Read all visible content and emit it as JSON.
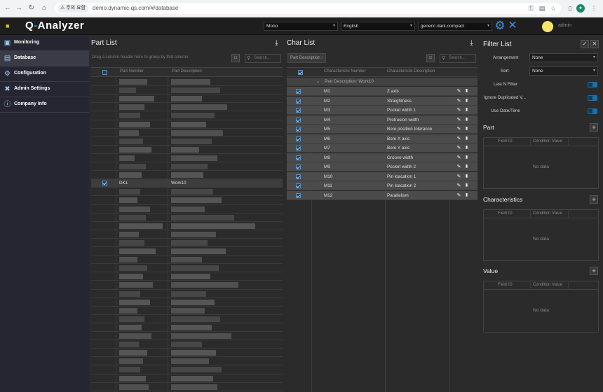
{
  "browser": {
    "security_label": "주의 요함",
    "url": "demo.dynamic-qs.com/#/database"
  },
  "header": {
    "logo": {
      "q": "Q",
      "dash": "-",
      "rest": "Analyzer"
    },
    "font_select": "Mono",
    "language_select": "English",
    "theme_select": "generic.dark.compact",
    "user": "admin"
  },
  "sidebar": {
    "items": [
      {
        "label": "Monitoring",
        "icon": "monitor-icon"
      },
      {
        "label": "Database",
        "icon": "database-icon"
      },
      {
        "label": "Configuration",
        "icon": "gear-icon"
      },
      {
        "label": "Admin Settings",
        "icon": "tools-icon"
      },
      {
        "label": "Company Info",
        "icon": "info-icon"
      }
    ],
    "active": "Database"
  },
  "part_list": {
    "title": "Part List",
    "group_hint": "Drag a column header here to group by that column",
    "search_placeholder": "Search...",
    "columns": [
      "Part Number",
      "Part Description"
    ],
    "selected_row": {
      "part_number": "DK1",
      "part_description": "Work10"
    }
  },
  "char_list": {
    "title": "Char List",
    "group_chip": "Part Description",
    "search_placeholder": "Search...",
    "columns": [
      "Characteristic Number",
      "Characteristic Description"
    ],
    "group_label": "Part Description: Work10",
    "rows": [
      {
        "number": "M1",
        "description": "Z axis"
      },
      {
        "number": "M2",
        "description": "Straightness"
      },
      {
        "number": "M3",
        "description": "Pocket width 1"
      },
      {
        "number": "M4",
        "description": "Protrusion width"
      },
      {
        "number": "M5",
        "description": "Bore position tolerance"
      },
      {
        "number": "M6",
        "description": "Bore X axis"
      },
      {
        "number": "M7",
        "description": "Bore Y axis"
      },
      {
        "number": "M8",
        "description": "Groove width"
      },
      {
        "number": "M9",
        "description": "Pocket width 2"
      },
      {
        "number": "M10",
        "description": "Pin loacation 1"
      },
      {
        "number": "M11",
        "description": "Pin loacation 2"
      },
      {
        "number": "M12",
        "description": "Parallelism"
      }
    ]
  },
  "filter_list": {
    "title": "Filter List",
    "arrangement_label": "Arrangement",
    "arrangement_value": "None",
    "sort_label": "Sort",
    "sort_value": "None",
    "last_n_label": "Last N Filter",
    "ignore_dup_label": "Ignore Duplicated V...",
    "use_date_label": "Use Date/Time",
    "sections": [
      {
        "title": "Part",
        "col1": "Field ID",
        "col2": "Condition Value",
        "empty": "No data"
      },
      {
        "title": "Characteristics",
        "col1": "Field ID",
        "col2": "Condition Value",
        "empty": "No data"
      },
      {
        "title": "Value",
        "col1": "Field ID",
        "col2": "Condition Value",
        "empty": "No data"
      }
    ]
  },
  "colors": {
    "accent": "#3b8ee0",
    "toggle_on": "#1e6fa8",
    "logo_dash": "#2a8fd6",
    "avatar": "#f5e56a"
  }
}
